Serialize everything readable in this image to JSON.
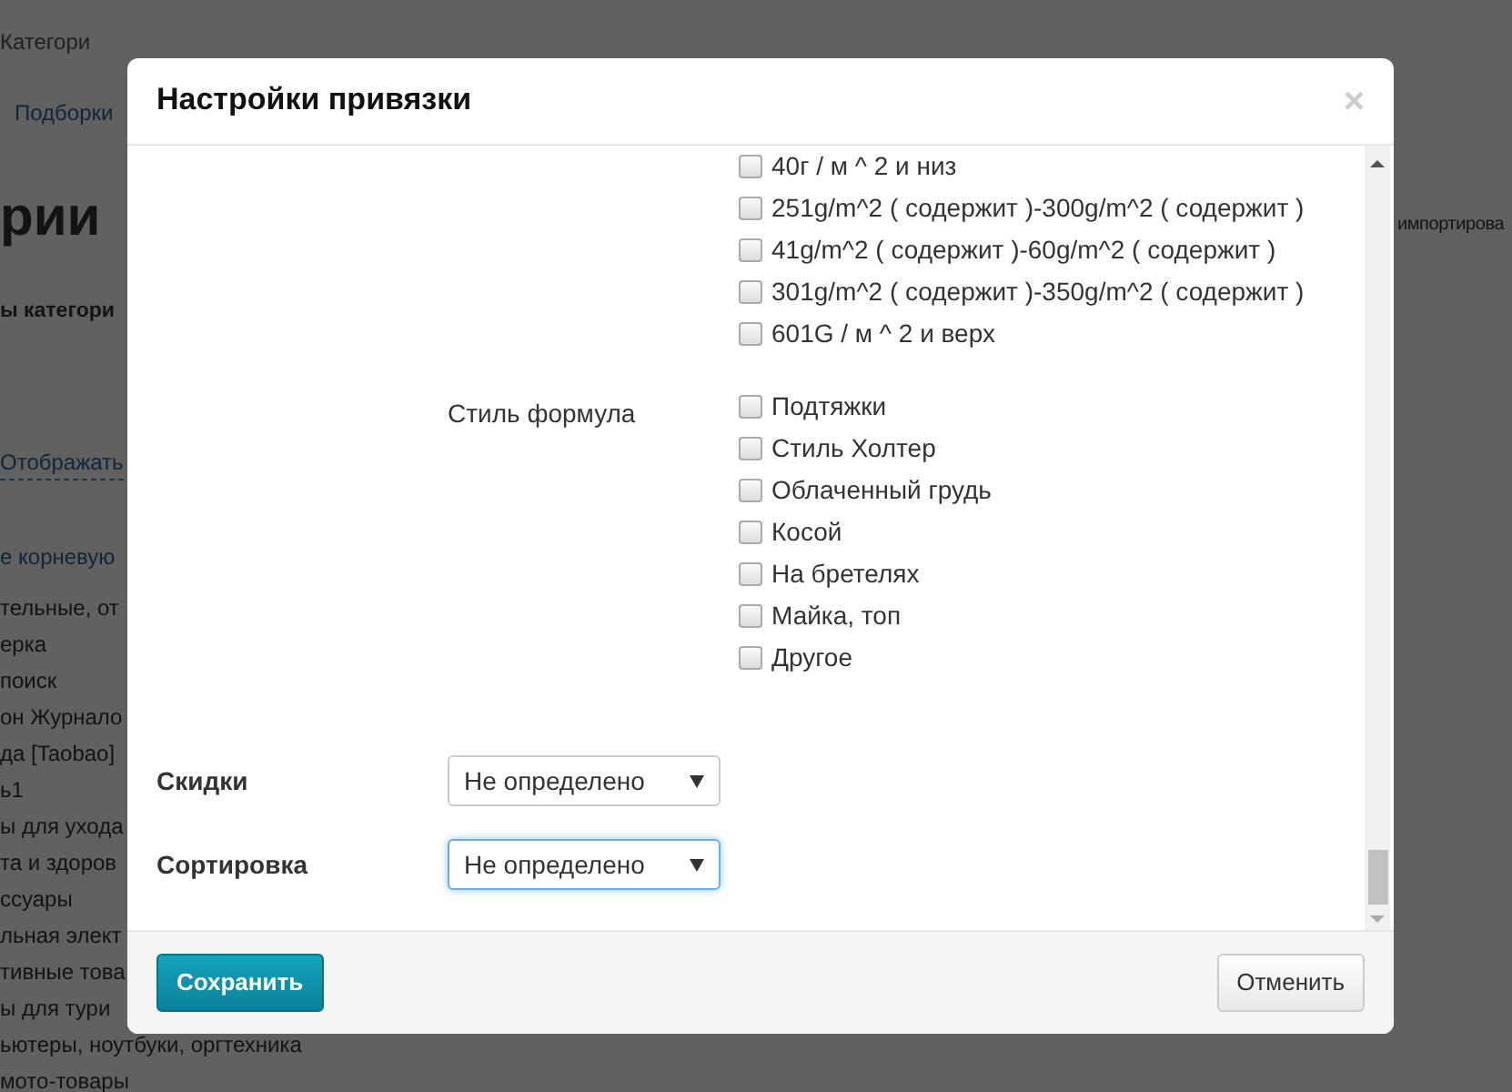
{
  "background": {
    "breadcrumb": "Категори",
    "tab": "Подборки",
    "heading": "рии",
    "right_text": "импортирова",
    "subheading": "ы категори",
    "toggle_link": "Отображать",
    "root_link": "е корневую",
    "items": [
      "тельные, от",
      "ерка",
      "поиск",
      "он Журнало",
      "да [Taobao]",
      "ь1",
      "ы для ухода",
      "та и здоров",
      "ссуары",
      "льная элект",
      "тивные това",
      "ы для тури",
      "ьютеры, ноутбуки, оргтехника",
      "мото-товары"
    ]
  },
  "dialog": {
    "title": "Настройки привязки",
    "close": "×",
    "groups": [
      {
        "options": [
          {
            "label": "40г / м ^ 2 и низ",
            "checked": false
          },
          {
            "label": "251g/m^2 ( содержит )-300g/m^2 ( содержит )",
            "checked": false
          },
          {
            "label": "41g/m^2 ( содержит )-60g/m^2 ( содержит )",
            "checked": false
          },
          {
            "label": "301g/m^2 ( содержит )-350g/m^2 ( содержит )",
            "checked": false
          },
          {
            "label": "601G / м ^ 2 и верх",
            "checked": false
          }
        ]
      },
      {
        "label": "Стиль формула",
        "options": [
          {
            "label": "Подтяжки",
            "checked": false
          },
          {
            "label": "Стиль Холтер",
            "checked": false
          },
          {
            "label": "Облаченный грудь",
            "checked": false
          },
          {
            "label": "Косой",
            "checked": false
          },
          {
            "label": "На бретелях",
            "checked": false
          },
          {
            "label": "Майка, топ",
            "checked": false
          },
          {
            "label": "Другое",
            "checked": false
          }
        ]
      }
    ],
    "fields": [
      {
        "label": "Скидки",
        "value": "Не определено",
        "focused": false
      },
      {
        "label": "Сортировка",
        "value": "Не определено",
        "focused": true
      }
    ],
    "buttons": [
      {
        "label": "Сохранить",
        "kind": "primary"
      },
      {
        "label": "Отменить",
        "kind": "default"
      }
    ]
  }
}
